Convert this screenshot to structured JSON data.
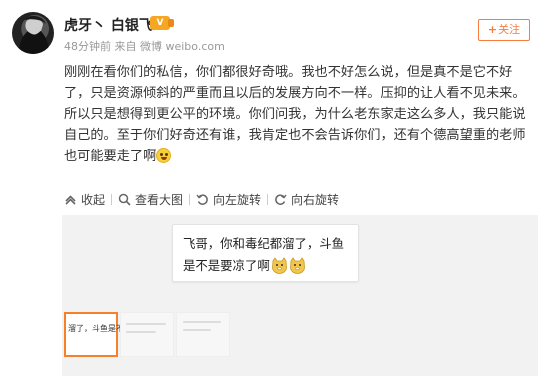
{
  "post": {
    "username": "虎牙丶 白银飞",
    "vip_badge_label": "V",
    "meta": "48分钟前 来自 微博 weibo.com",
    "follow_label": "关注",
    "follow_plus": "+",
    "content": "刚刚在看你们的私信，你们都很好奇哦。我也不好怎么说，但是真不是它不好了，只是资源倾斜的严重而且以后的发展方向不一样。压抑的让人看不见未来。所以只是想得到更公平的环境。你们问我，为什么老东家走这么多人，我只能说自己的。至于你们好奇还有谁，我肯定也不会告诉你们，还有个德高望重的老师也可能要走了啊"
  },
  "toolbar": {
    "collapse": "收起",
    "view_large": "查看大图",
    "rotate_left": "向左旋转",
    "rotate_right": "向右旋转"
  },
  "image_card": {
    "text": "飞哥，你和毒纪都溜了，斗鱼是不是要凉了啊"
  },
  "thumbnails": {
    "active_text": "溜了，斗鱼是不"
  },
  "colors": {
    "accent": "#f77c3d",
    "thumb_border": "#f5822a",
    "media_bg": "#f2f2f2"
  },
  "icons": [
    "collapse-icon",
    "magnifier-icon",
    "rotate-left-icon",
    "rotate-right-icon",
    "doge-emoji-icon",
    "laugh-emoji-icon"
  ]
}
